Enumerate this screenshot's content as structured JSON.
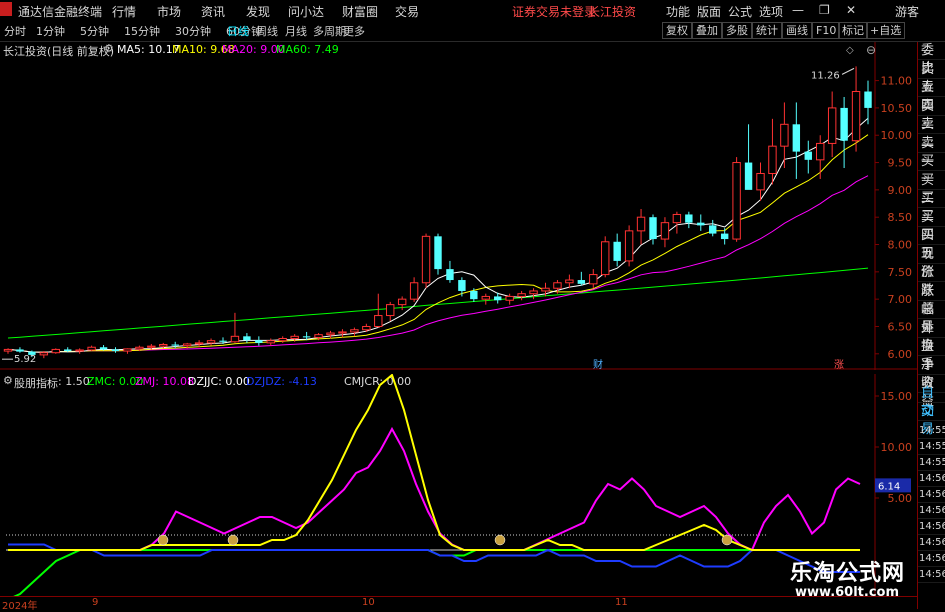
{
  "menubar": {
    "app_title": "通达信金融终端",
    "items": [
      "行情",
      "市场",
      "资讯",
      "发现",
      "问小达",
      "财富圈",
      "交易"
    ],
    "login_status": "证券交易未登录",
    "stock_name": "长江投资",
    "right_items": [
      "功能",
      "版面",
      "公式",
      "选项"
    ],
    "user": "游客"
  },
  "toolbar": {
    "periods": [
      "分时",
      "1分钟",
      "5分钟",
      "15分钟",
      "30分钟",
      "60分钟",
      "日线",
      "周线",
      "月线",
      "多周期",
      "更多"
    ],
    "active_period": "日线",
    "right_buttons": [
      "复权",
      "叠加",
      "多股",
      "统计",
      "画线",
      "F10",
      "标记",
      "+自选"
    ]
  },
  "main_chart": {
    "title": "长江投资(日线 前复权)",
    "ma5_label": "MA5: 10.17",
    "ma10_label": "MA10: 9.68",
    "ma20_label": "MA20: 9.00",
    "ma60_label": "MA60: 7.49",
    "colors": {
      "ma5": "#ffffff",
      "ma10": "#ffff00",
      "ma20": "#ff00ff",
      "ma60": "#00ff00",
      "up": "#ff3232",
      "down": "#54ffff"
    },
    "y_ticks": [
      "11.00",
      "10.50",
      "10.00",
      "9.50",
      "9.00",
      "8.50",
      "8.00",
      "7.50",
      "7.00",
      "6.50",
      "6.00"
    ],
    "high_marker": "11.26",
    "low_marker": "5.92",
    "markers": [
      {
        "text": "财",
        "color": "#4fb0ff"
      },
      {
        "text": "涨",
        "color": "#ff5050"
      }
    ]
  },
  "indicator": {
    "name": "股朋指标",
    "param": ": 1.50",
    "zmc": "ZMC: 0.00",
    "zmj": "ZMJ: 10.08",
    "dzjjc": "DZJJC: 0.00",
    "dzjdz": "DZJDZ: -4.13",
    "zlzl": "ZLZL: ...",
    "cmjcr": "CMJCR: 0.00",
    "y_ticks": [
      "15.00",
      "10.00",
      "5.00"
    ],
    "current_value": "6.14"
  },
  "xaxis": {
    "labels": [
      "2024年",
      "9",
      "10",
      "11"
    ]
  },
  "sidebar": {
    "items": [
      "委比",
      "卖五",
      "卖四",
      "卖三",
      "卖二",
      "卖一",
      "买一",
      "买二",
      "买三",
      "买四",
      "买五",
      "现价",
      "涨跌",
      "涨幅",
      "总量",
      "外盘",
      "换手",
      "净资",
      "收益"
    ],
    "auto_trade": [
      "自动",
      "交易"
    ],
    "times": [
      "14:55",
      "14:55",
      "14:55",
      "14:56",
      "14:56",
      "14:56",
      "14:56",
      "14:56",
      "14:56",
      "14:56"
    ]
  },
  "watermark": {
    "title": "乐淘公式网",
    "url": "www.60lt.com"
  },
  "chart_data": {
    "type": "candlestick",
    "candles": [
      [
        6.05,
        6.1,
        6.0,
        6.08
      ],
      [
        6.08,
        6.12,
        6.02,
        6.04
      ],
      [
        6.04,
        6.06,
        5.94,
        5.98
      ],
      [
        5.98,
        6.05,
        5.92,
        6.02
      ],
      [
        6.02,
        6.1,
        6.0,
        6.08
      ],
      [
        6.08,
        6.12,
        6.03,
        6.05
      ],
      [
        6.05,
        6.1,
        6.0,
        6.07
      ],
      [
        6.07,
        6.15,
        6.05,
        6.12
      ],
      [
        6.12,
        6.16,
        6.06,
        6.08
      ],
      [
        6.08,
        6.12,
        6.02,
        6.05
      ],
      [
        6.05,
        6.1,
        6.0,
        6.09
      ],
      [
        6.09,
        6.15,
        6.05,
        6.12
      ],
      [
        6.12,
        6.18,
        6.08,
        6.14
      ],
      [
        6.14,
        6.2,
        6.1,
        6.17
      ],
      [
        6.17,
        6.22,
        6.1,
        6.15
      ],
      [
        6.15,
        6.2,
        6.1,
        6.18
      ],
      [
        6.18,
        6.25,
        6.12,
        6.2
      ],
      [
        6.2,
        6.28,
        6.15,
        6.24
      ],
      [
        6.24,
        6.3,
        6.18,
        6.22
      ],
      [
        6.22,
        6.75,
        6.2,
        6.32
      ],
      [
        6.32,
        6.38,
        6.2,
        6.25
      ],
      [
        6.25,
        6.32,
        6.15,
        6.2
      ],
      [
        6.2,
        6.28,
        6.15,
        6.24
      ],
      [
        6.24,
        6.32,
        6.2,
        6.28
      ],
      [
        6.28,
        6.36,
        6.22,
        6.32
      ],
      [
        6.32,
        6.4,
        6.25,
        6.3
      ],
      [
        6.3,
        6.38,
        6.25,
        6.35
      ],
      [
        6.35,
        6.42,
        6.28,
        6.38
      ],
      [
        6.38,
        6.45,
        6.3,
        6.4
      ],
      [
        6.4,
        6.48,
        6.32,
        6.44
      ],
      [
        6.44,
        6.55,
        6.4,
        6.5
      ],
      [
        6.5,
        7.1,
        6.48,
        6.7
      ],
      [
        6.7,
        6.95,
        6.6,
        6.9
      ],
      [
        6.9,
        7.05,
        6.8,
        7.0
      ],
      [
        7.0,
        7.4,
        6.95,
        7.3
      ],
      [
        7.3,
        8.2,
        7.2,
        8.15
      ],
      [
        8.15,
        8.2,
        7.45,
        7.55
      ],
      [
        7.55,
        7.7,
        7.3,
        7.35
      ],
      [
        7.35,
        7.4,
        7.05,
        7.15
      ],
      [
        7.15,
        7.2,
        6.95,
        7.0
      ],
      [
        7.0,
        7.1,
        6.9,
        7.05
      ],
      [
        7.05,
        7.12,
        6.92,
        6.98
      ],
      [
        6.98,
        7.1,
        6.9,
        7.05
      ],
      [
        7.05,
        7.15,
        6.98,
        7.1
      ],
      [
        7.1,
        7.2,
        7.0,
        7.15
      ],
      [
        7.15,
        7.3,
        7.05,
        7.2
      ],
      [
        7.2,
        7.35,
        7.1,
        7.3
      ],
      [
        7.3,
        7.45,
        7.2,
        7.35
      ],
      [
        7.35,
        7.5,
        7.25,
        7.28
      ],
      [
        7.28,
        7.55,
        7.2,
        7.45
      ],
      [
        7.45,
        8.15,
        7.4,
        8.05
      ],
      [
        8.05,
        8.2,
        7.6,
        7.7
      ],
      [
        7.7,
        8.35,
        7.6,
        8.25
      ],
      [
        8.25,
        8.65,
        8.0,
        8.5
      ],
      [
        8.5,
        8.55,
        8.0,
        8.1
      ],
      [
        8.1,
        8.5,
        7.95,
        8.4
      ],
      [
        8.4,
        8.6,
        8.2,
        8.55
      ],
      [
        8.55,
        8.6,
        8.3,
        8.4
      ],
      [
        8.4,
        8.55,
        8.25,
        8.35
      ],
      [
        8.35,
        8.45,
        8.15,
        8.2
      ],
      [
        8.2,
        8.3,
        8.0,
        8.1
      ],
      [
        8.1,
        9.6,
        8.05,
        9.5
      ],
      [
        9.5,
        10.2,
        9.3,
        9.0
      ],
      [
        9.0,
        9.5,
        8.8,
        9.3
      ],
      [
        9.3,
        10.3,
        9.1,
        9.8
      ],
      [
        9.8,
        10.6,
        9.4,
        10.2
      ],
      [
        10.2,
        10.6,
        9.2,
        9.7
      ],
      [
        9.7,
        9.9,
        9.3,
        9.55
      ],
      [
        9.55,
        10.0,
        9.2,
        9.85
      ],
      [
        9.85,
        10.8,
        9.6,
        10.5
      ],
      [
        10.5,
        10.7,
        9.4,
        9.9
      ],
      [
        9.9,
        11.26,
        9.7,
        10.8
      ],
      [
        10.8,
        11.0,
        10.2,
        10.5
      ]
    ],
    "indicator_series": [
      {
        "name": "ZMJ",
        "color": "#ff00ff"
      },
      {
        "name": "ZMC",
        "color": "#ffff00"
      },
      {
        "name": "DZJDZ",
        "color": "#1e3cff"
      },
      {
        "name": "DZJJC",
        "color": "#00ff00"
      }
    ]
  }
}
